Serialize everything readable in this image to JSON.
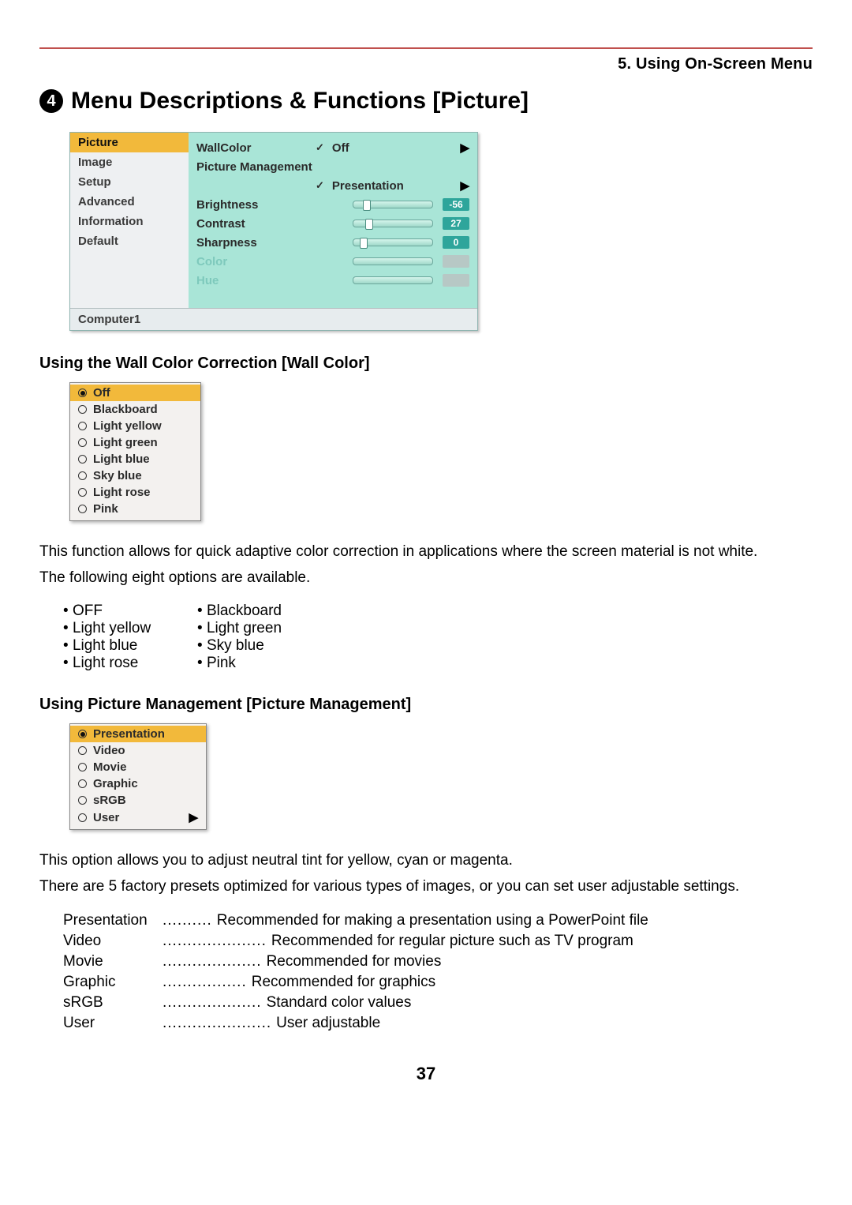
{
  "chapter_header": "5. Using On-Screen Menu",
  "section_number": "4",
  "section_title": "Menu Descriptions & Functions [Picture]",
  "osd": {
    "menu_items": [
      "Picture",
      "Image",
      "Setup",
      "Advanced",
      "Information",
      "Default"
    ],
    "selected_menu": "Picture",
    "panel": {
      "wallcolor_label": "WallColor",
      "wallcolor_value": "Off",
      "pm_label": "Picture Management",
      "pm_value": "Presentation",
      "brightness_label": "Brightness",
      "brightness_value": "-56",
      "brightness_pos_pct": 12,
      "contrast_label": "Contrast",
      "contrast_value": "27",
      "contrast_pos_pct": 15,
      "sharpness_label": "Sharpness",
      "sharpness_value": "0",
      "sharpness_pos_pct": 8,
      "color_label": "Color",
      "hue_label": "Hue"
    },
    "source_label": "Computer1"
  },
  "wall_heading": "Using the Wall Color Correction [Wall Color]",
  "wall_popup": [
    "Off",
    "Blackboard",
    "Light yellow",
    "Light green",
    "Light blue",
    "Sky blue",
    "Light rose",
    "Pink"
  ],
  "wall_body_1": "This function allows for quick adaptive color correction in applications where the screen material is not white.",
  "wall_body_2": "The following eight options are available.",
  "wall_bullets_a": [
    "OFF",
    "Light yellow",
    "Light blue",
    "Light rose"
  ],
  "wall_bullets_b": [
    "Blackboard",
    "Light green",
    "Sky blue",
    "Pink"
  ],
  "pm_heading": "Using Picture Management [Picture Management]",
  "pm_popup": [
    "Presentation",
    "Video",
    "Movie",
    "Graphic",
    "sRGB",
    "User"
  ],
  "pm_body_1": "This option allows you to adjust neutral tint for yellow, cyan or magenta.",
  "pm_body_2": "There are 5 factory presets optimized for various types of images, or you can set user adjustable settings.",
  "pm_defs": [
    {
      "t": "Presentation",
      "dots": "..........",
      "d": "Recommended for making a presentation using a PowerPoint file"
    },
    {
      "t": "Video",
      "dots": ".....................",
      "d": "Recommended for regular picture such as TV program"
    },
    {
      "t": "Movie",
      "dots": "....................",
      "d": "Recommended for movies"
    },
    {
      "t": "Graphic",
      "dots": ".................",
      "d": "Recommended for graphics"
    },
    {
      "t": "sRGB",
      "dots": "....................",
      "d": "Standard color values"
    },
    {
      "t": "User",
      "dots": "......................",
      "d": "User adjustable"
    }
  ],
  "page_number": "37"
}
